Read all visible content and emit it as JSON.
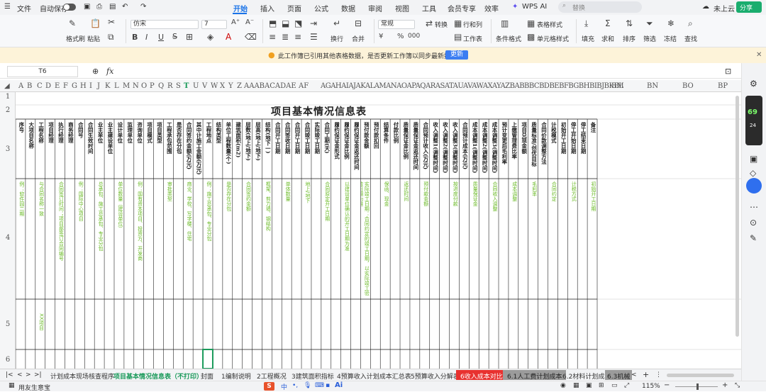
{
  "titlebar": {
    "file": "文件",
    "autosave": "自动保存",
    "tabs": [
      "开始",
      "插入",
      "页面",
      "公式",
      "数据",
      "审阅",
      "视图",
      "工具",
      "会员专享",
      "效率"
    ],
    "ai": "WPS AI",
    "search_placeholder": "替换",
    "cloud": "未上云",
    "share": "分享"
  },
  "ribbon": {
    "format_painter": "格式刷",
    "paste": "粘贴",
    "font": "仿宋",
    "font_size": "7",
    "wrap": "换行",
    "merge": "合并",
    "number_format": "常规",
    "convert": "转换",
    "row_col": "行和列",
    "worksheet": "工作表",
    "cond_format": "条件格式",
    "table_style": "表格样式",
    "cell_style": "单元格样式",
    "fill": "填充",
    "sum": "求和",
    "filter": "筛选",
    "freeze": "冻结",
    "find": "查找"
  },
  "notification": {
    "text": "此工作簿已引用其他表格数据，是否更新工作簿以同步最新数据？",
    "button": "更新"
  },
  "formula": {
    "cell_ref": "T6",
    "fx": "fx"
  },
  "columns": {
    "left": [
      "A",
      "B",
      "C",
      "D",
      "E",
      "F",
      "G",
      "H",
      "I",
      "J",
      "K",
      "L",
      "M",
      "N",
      "O",
      "P",
      "Q",
      "R",
      "S",
      "T",
      "U",
      "V",
      "W",
      "X",
      "Y",
      "Z",
      "AAABACADAE",
      "AF",
      "AGAHAIAJAKALAMANAOAPAQARASATAUAVAWAXAYAZBABBBCBDBEBFBGBHBIBJBKBL"
    ],
    "right": [
      "BM",
      "BN",
      "BO",
      "BP"
    ]
  },
  "rows": [
    "1",
    "2",
    "3",
    "4",
    "5",
    "6"
  ],
  "sheet": {
    "title": "项目基本情况信息表",
    "headers": [
      "序号",
      "大项目名称",
      "工程名称",
      "项目经理",
      "执行经理",
      "商务经理",
      "合同号",
      "合同生效时间",
      "业主单位",
      "业主建设单位",
      "设计单位",
      "监理单位",
      "咨询单位",
      "项目模式",
      "项目类型",
      "工程承包范围",
      "是否存在分包",
      "合同签约金额(万元)",
      "其中计施工金额(万元)",
      "工程地点",
      "结构类型",
      "单位工程数量(个)",
      "建筑面积(m2)",
      "层数(地上/地下)",
      "层高(地上/地下)",
      "结构(地下一)",
      "合同开工日期",
      "合同签收日期",
      "合同开工日期",
      "合同竣工日期",
      "实际竣工日期",
      "合同工期(天)",
      "履约保证金形式",
      "履约保证金比例",
      "履约保证金返还时间",
      "预付款金额",
      "预付款扣回",
      "结算条件",
      "付款比例",
      "质量保证金比例",
      "质量保证金返还时间",
      "合同预计收入(万元)",
      "收入调整1(调整时间)",
      "收入调整2(调整时间)",
      "收入调整3(调整时间)",
      "合同预计成本(万元)",
      "成本调整1(调整时间)",
      "成本调整2(调整时间)",
      "成本调整3(调整时间)",
      "预计变更后毛利率",
      "上缴管理费比率",
      "项目兑现金额",
      "质量标准/创优目标",
      "合同价款调整方法",
      "计税模式",
      "初始开工日期",
      "停工开始日期",
      "停工结束日期",
      "备注"
    ],
    "row4": [
      "例：软件园二期",
      "与合同名称一致",
      "合同签订时间；项目部签订合同编号",
      "例：国际中心项目",
      "总承包、施工总承包、专业分包",
      "单位数量（建设单位）",
      "例：国有资本项目、投资方、开发商",
      "审批类型",
      "商业、学校、写字楼、住宅",
      "例：施工总承包、专业分包",
      "是否存在分包",
      "合同签约金额",
      "框架、剪力墙、钢结构",
      "单体数量",
      "地上/地下",
      "合同原定开工日期",
      "以建设单位确认的开工日期为准",
      "实际竣工日期：合同约定的竣工日期，以实际竣工验收日期为准",
      "保函、现金",
      "返还时间",
      "预付款金额",
      "按进度付款",
      "质量保证金",
      "合同收入调整",
      "成本调整",
      "毛利率",
      "合同约定",
      "计税方式",
      "初始开工日期"
    ],
    "row5": [
      "XX项目"
    ]
  },
  "sheet_tabs": [
    "计划成本现场核查程序",
    "项目基本情况信息表（不打印）",
    "封面",
    "1编制说明",
    "2工程概况",
    "3建筑面积指标",
    "4预算收入计划成本汇总表",
    "5预算收入分解表",
    "6收入成本对比",
    "6.1人工费计划成本",
    "6.2材料计划成本",
    "6.3机械"
  ],
  "status": {
    "app": "用友生意宝",
    "zoom": "115%"
  }
}
